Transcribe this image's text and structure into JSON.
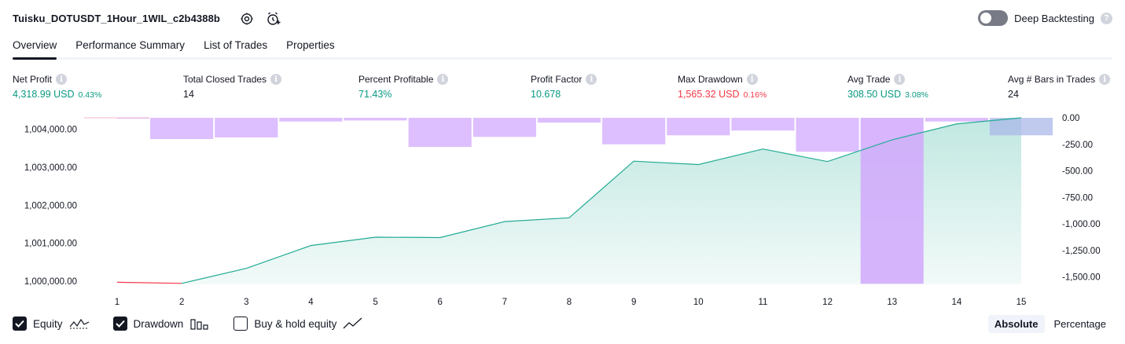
{
  "header": {
    "strategy_name": "Tuisku_DOTUSDT_1Hour_1WIL_c2b4388b",
    "settings_icon": "gear-icon",
    "alert_icon": "alarm-clock-plus-icon",
    "deep_backtesting_label": "Deep Backtesting",
    "deep_backtesting_on": false,
    "help_glyph": "?"
  },
  "tabs": [
    {
      "label": "Overview",
      "active": true
    },
    {
      "label": "Performance Summary",
      "active": false
    },
    {
      "label": "List of Trades",
      "active": false
    },
    {
      "label": "Properties",
      "active": false
    }
  ],
  "metrics": [
    {
      "label": "Net Profit",
      "value": "4,318.99 USD",
      "pct": "0.43%",
      "color": "#089981"
    },
    {
      "label": "Total Closed Trades",
      "value": "14",
      "pct": "",
      "color": "#131722"
    },
    {
      "label": "Percent Profitable",
      "value": "71.43%",
      "pct": "",
      "color": "#089981"
    },
    {
      "label": "Profit Factor",
      "value": "10.678",
      "pct": "",
      "color": "#089981"
    },
    {
      "label": "Max Drawdown",
      "value": "1,565.32 USD",
      "pct": "0.16%",
      "color": "#f23645"
    },
    {
      "label": "Avg Trade",
      "value": "308.50 USD",
      "pct": "3.08%",
      "color": "#089981"
    },
    {
      "label": "Avg # Bars in Trades",
      "value": "24",
      "pct": "",
      "color": "#131722"
    }
  ],
  "info_glyph": "i",
  "chart_data": {
    "type": "line",
    "x": [
      1,
      2,
      3,
      4,
      5,
      6,
      7,
      8,
      9,
      10,
      11,
      12,
      13,
      14,
      15
    ],
    "left_axis": {
      "ticks": [
        "1,004,000.00",
        "1,003,000.00",
        "1,002,000.00",
        "1,001,000.00",
        "1,000,000.00"
      ],
      "tick_values": [
        1004000,
        1003000,
        1002000,
        1001000,
        1000000
      ],
      "range": [
        999920,
        1004300
      ]
    },
    "right_axis": {
      "ticks": [
        "0.00",
        "-250.00",
        "-500.00",
        "-750.00",
        "-1,000.00",
        "-1,250.00",
        "-1,500.00"
      ],
      "tick_values": [
        0,
        -250,
        -500,
        -750,
        -1000,
        -1250,
        -1500
      ],
      "range": [
        -1570,
        0
      ]
    },
    "series": [
      {
        "name": "Equity",
        "values": [
          999975,
          999945,
          1000340,
          1000940,
          1001160,
          1001150,
          1001570,
          1001670,
          1003160,
          1003070,
          1003480,
          1003150,
          1003720,
          1004140,
          1004300
        ]
      },
      {
        "name": "Drawdown",
        "values": [
          -5,
          -200,
          -185,
          -35,
          -25,
          -275,
          -180,
          -45,
          -250,
          -165,
          -120,
          -320,
          -1565,
          -35,
          -165
        ]
      }
    ],
    "colors": {
      "equity_line": "#22ab94",
      "equity_loss_line": "#f23645",
      "equity_fill": "#22ab94",
      "drawdown_bar": "#d1a8fd",
      "overlap_bar": "#aab8e8"
    }
  },
  "legend": [
    {
      "label": "Equity",
      "checked": true,
      "icon": "equity-line-icon"
    },
    {
      "label": "Drawdown",
      "checked": true,
      "icon": "bars-icon"
    },
    {
      "label": "Buy & hold equity",
      "checked": false,
      "icon": "trend-line-icon"
    }
  ],
  "scale_toggle": {
    "options": [
      "Absolute",
      "Percentage"
    ],
    "selected": "Absolute"
  }
}
